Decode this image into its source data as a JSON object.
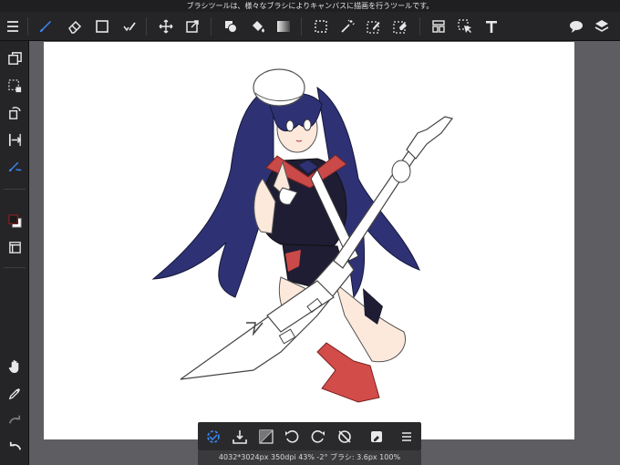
{
  "tip_text": "ブラシツールは、様々なブラシによりキャンバスに描画を行うツールです。",
  "status_text": "4032*3024px 350dpi 43% -2° ブラシ: 3.6px 100%",
  "colors": {
    "accent": "#3d8bff",
    "primary_color": "#1a1a1a",
    "secondary_color": "#ffffff",
    "panel": "#252527",
    "workspace": "#5e5e62"
  },
  "toolbar": {
    "left": [
      "menu-icon"
    ],
    "tools": [
      "brush-icon",
      "eraser-icon",
      "rectangle-shape-icon",
      "multi-brush-icon"
    ],
    "transform": [
      "move-icon",
      "transform-icon"
    ],
    "fill": [
      "shape-fill-icon",
      "bucket-fill-icon",
      "gradient-icon"
    ],
    "selection": [
      "select-rect-icon",
      "magic-wand-icon",
      "select-pen-icon",
      "select-eraser-icon"
    ],
    "other": [
      "frame-divider-icon",
      "operation-icon",
      "text-icon"
    ],
    "right": [
      "speech-bubble-icon",
      "layers-icon"
    ]
  },
  "leftbar": {
    "top": [
      "canvas-copy-icon",
      "selection-transform-icon",
      "rotate-layer-icon",
      "flip-icon",
      "brush-settings-icon"
    ],
    "colors": [
      "color-swatch-icon",
      "snap-icon"
    ],
    "bottom": [
      "hand-icon",
      "eyedropper-icon",
      "redo-icon",
      "undo-icon"
    ]
  },
  "bottombar": [
    "deselect-icon",
    "import-selection-icon",
    "invert-selection-icon",
    "rotate-left-icon",
    "rotate-right-icon",
    "reset-rotation-icon",
    "reference-icon",
    "more-menu-icon"
  ]
}
